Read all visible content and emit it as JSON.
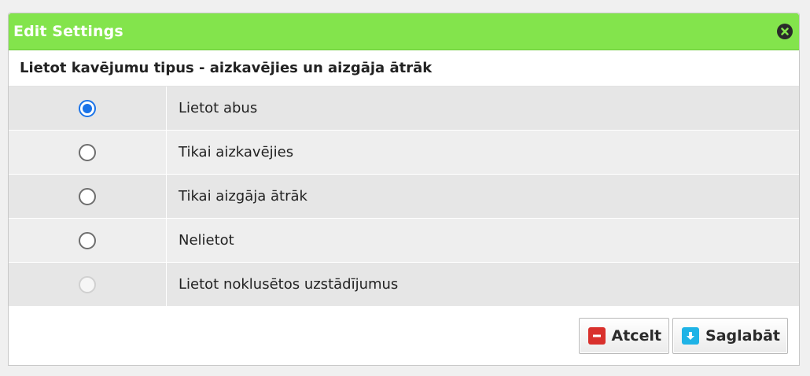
{
  "dialog": {
    "title": "Edit Settings"
  },
  "section": {
    "title": "Lietot kavējumu tipus - aizkavējies un aizgāja ātrāk"
  },
  "options": [
    {
      "label": "Lietot abus",
      "state": "checked"
    },
    {
      "label": "Tikai aizkavējies",
      "state": "unchecked"
    },
    {
      "label": "Tikai aizgāja ātrāk",
      "state": "unchecked"
    },
    {
      "label": "Nelietot",
      "state": "unchecked"
    },
    {
      "label": "Lietot noklusētos uzstādījumus",
      "state": "disabled"
    }
  ],
  "footer": {
    "cancel_label": "Atcelt",
    "save_label": "Saglabāt"
  },
  "colors": {
    "titlebar": "#83e44c",
    "radio_selected": "#1a73e8",
    "cancel_icon": "#d9302c",
    "save_icon": "#1fb3e6"
  },
  "icons": {
    "close": "close-circle-icon",
    "cancel": "minus-icon",
    "save": "download-arrow-icon"
  }
}
